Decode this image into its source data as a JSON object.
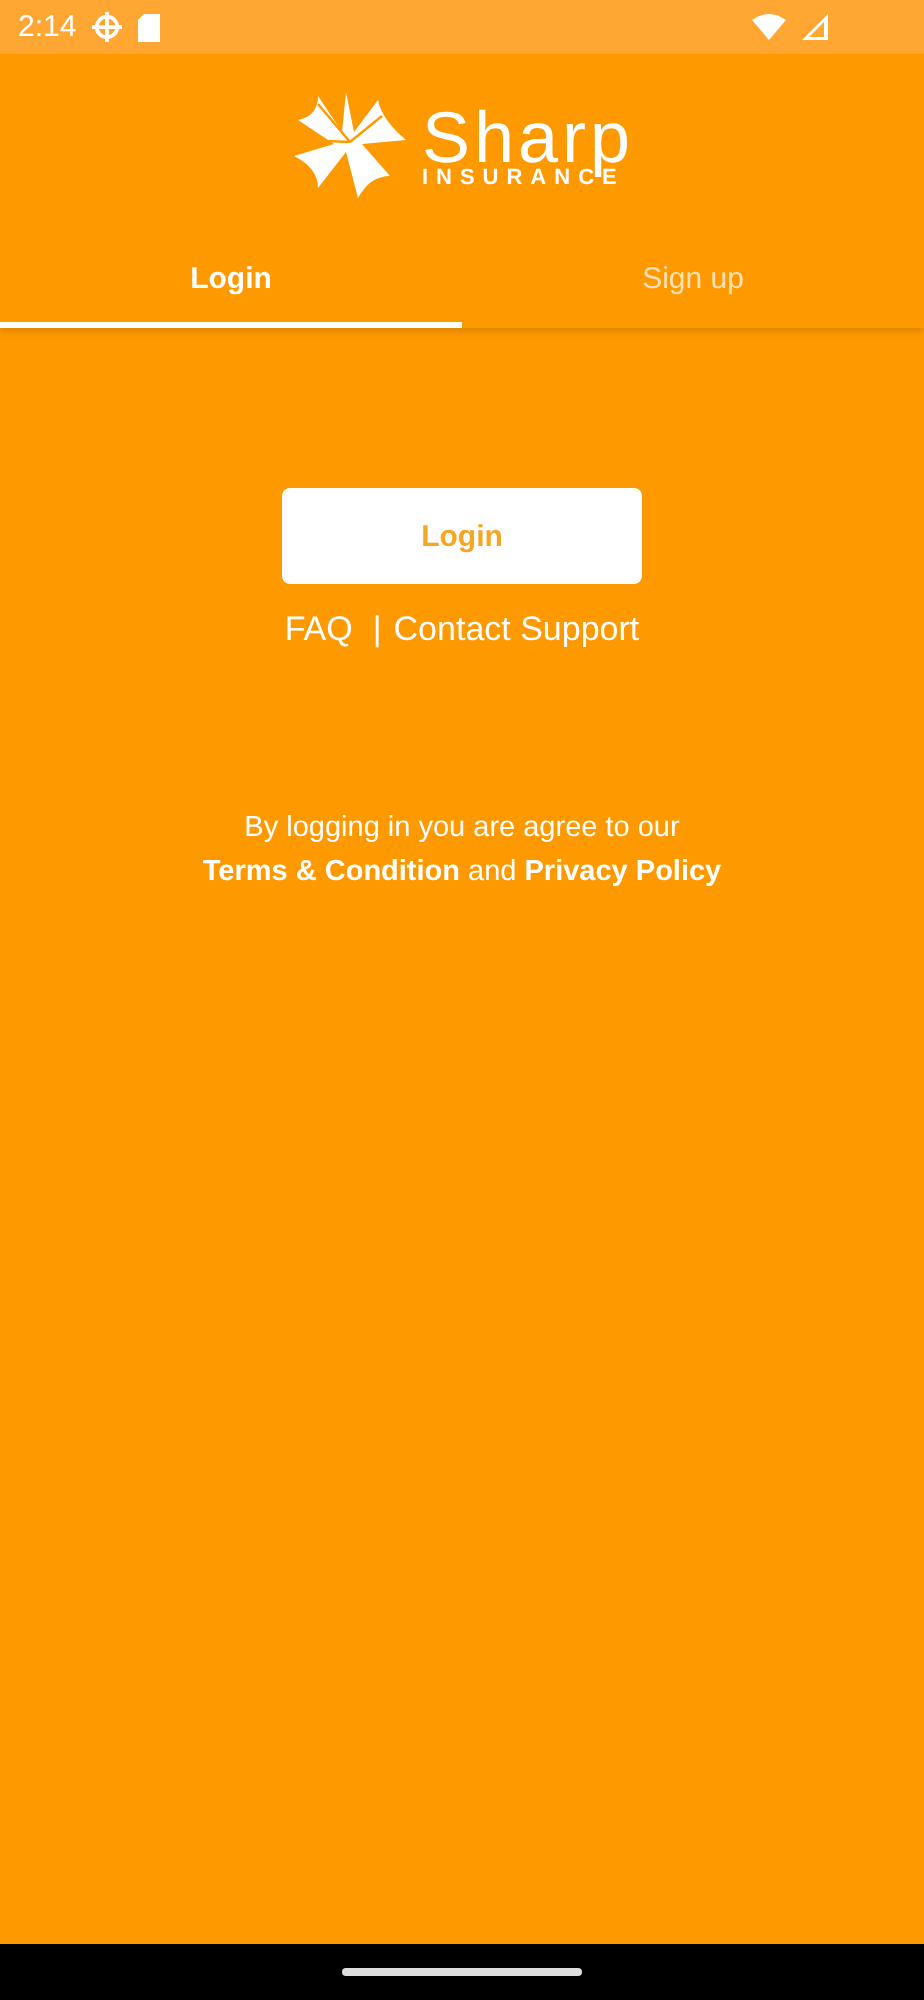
{
  "status_bar": {
    "time": "2:14"
  },
  "logo": {
    "name": "Sharp",
    "tagline": "INSURANCE"
  },
  "tabs": [
    {
      "label": "Login",
      "selected": true
    },
    {
      "label": "Sign up",
      "selected": false
    }
  ],
  "login_button": "Login",
  "help_links": [
    {
      "label": "FAQ"
    },
    {
      "label": "Contact Support"
    }
  ],
  "separator": "|",
  "agreement": {
    "text": "By logging in you are agree to our",
    "terms_link": "Terms & Condition",
    "joiner": "and",
    "privacy_link": "Privacy Policy"
  }
}
